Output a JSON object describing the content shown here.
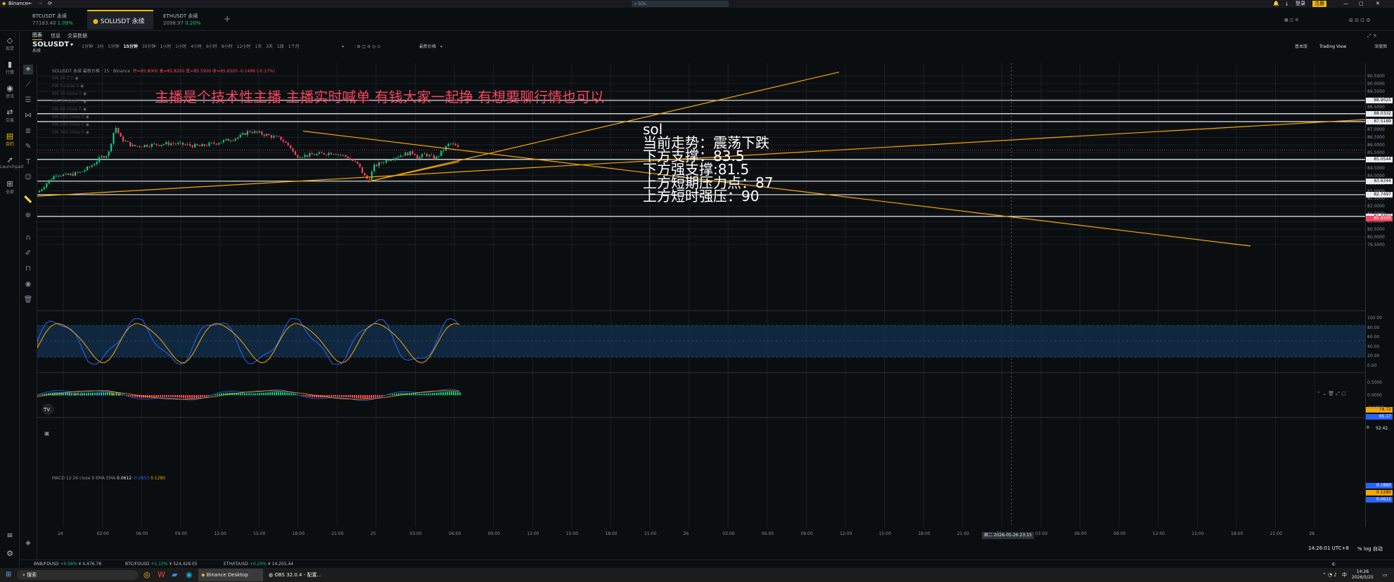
{
  "window": {
    "title": "Binance"
  },
  "tabs": [
    {
      "name": "BTCUSDT 永续",
      "price": "77183.40",
      "change": "1.09%"
    },
    {
      "name": "SOLUSDT 永续"
    },
    {
      "name": "ETHUSDT 永续",
      "price": "2098.97",
      "change": "0.20%"
    }
  ],
  "search": {
    "placeholder": "SOL"
  },
  "top_right": {
    "login": "登录",
    "register": "注册"
  },
  "left_nav": [
    {
      "label": "现货",
      "icon": "diamond-icon"
    },
    {
      "label": "行情",
      "icon": "bar-chart-icon"
    },
    {
      "label": "资讯",
      "icon": "news-icon"
    },
    {
      "label": "交易",
      "icon": "exchange-icon"
    },
    {
      "label": "合约",
      "icon": "contract-icon"
    },
    {
      "label": "Launchpad",
      "icon": "rocket-icon"
    },
    {
      "label": "全部",
      "icon": "grid-icon"
    }
  ],
  "subtabs": [
    "图表",
    "信息",
    "交易数据"
  ],
  "symbol": {
    "name": "SOLUSDT",
    "sub": "永续"
  },
  "intervals": [
    "1分钟",
    "3分",
    "5分钟",
    "15分钟",
    "30分钟",
    "1小时",
    "2小时",
    "4小时",
    "6小时",
    "8小时",
    "12小时",
    "1天",
    "3天",
    "1周",
    "1个月"
  ],
  "active_interval": "15分钟",
  "price_type": "最新价格",
  "views": [
    "基本版",
    "Trading View",
    "深度图"
  ],
  "legend": {
    "title": "SOLUSDT 永续 最新价格 · 15 · Binance",
    "ohlc": "开=85.8000 高=85.8200 低=85.5900 收=85.6500 -0.1499 (-0.17%)",
    "mas": [
      "MA 20 2 0",
      "MA 5 close 0",
      "MA 10 close 0",
      "MA 30 close 0",
      "MA 60 close 0",
      "MA 120 close 0",
      "MA 240 close 0",
      "MA 360 close 0"
    ]
  },
  "stream_banner": "主播是个技术性主播 主播实时喊单 有钱大家一起挣 有想要聊行情也可以",
  "analysis": {
    "symbol": "sol",
    "lines": [
      "当前走势：震荡下跌",
      "下方支撑：83.5",
      "下方强支撑:81.5",
      "上方短期压力点：87",
      "上方短时强压：90"
    ]
  },
  "price_axis": {
    "ticks": [
      "90.5000",
      "90.0000",
      "89.5000",
      "89.0000",
      "88.5000",
      "88.0000",
      "87.5000",
      "87.0000",
      "86.5000",
      "86.0000",
      "85.5000",
      "85.0000",
      "84.5000",
      "84.0000",
      "83.5000",
      "83.0000",
      "82.5000",
      "82.0000",
      "81.5000",
      "81.0000",
      "80.5000",
      "80.0000",
      "79.5000"
    ],
    "levels": [
      "88.9025",
      "88.0332",
      "87.5189",
      "85.0544",
      "83.6344",
      "82.7497",
      "81.3307"
    ],
    "current": "85.6500"
  },
  "stoch": {
    "legend": "Stoch RSI 14 14 3 3",
    "k": "65.17",
    "d": "79.72",
    "ticks": [
      "100.00",
      "80.00",
      "60.00",
      "40.00",
      "20.00",
      "0.00"
    ],
    "mid": "52.42",
    "k_label": "65.17",
    "d_label": "79.72"
  },
  "macd": {
    "legend": "MACD 12 26 close 9 EMA EMA",
    "v1": "0.0612",
    "v2": "-0.0853",
    "v3": "0.1280",
    "labels": [
      "0.1893",
      "0.1280",
      "0.0612"
    ],
    "ticks": [
      "0.5000",
      "0.0000",
      "-0.5000"
    ]
  },
  "time_axis": [
    "24",
    "03:00",
    "06:00",
    "09:00",
    "12:00",
    "15:00",
    "18:00",
    "21:00",
    "25",
    "03:00",
    "06:00",
    "09:00",
    "12:00",
    "15:00",
    "18:00",
    "21:00",
    "26",
    "03:00",
    "06:00",
    "09:00",
    "12:00",
    "15:00",
    "18:00",
    "21:00",
    "27",
    "03:00",
    "06:00",
    "09:00",
    "12:00",
    "15:00",
    "18:00",
    "21:00",
    "28"
  ],
  "crosshair_time": "周二 2026-05-26  23:15",
  "clock": "14:26:01 UTC+8",
  "scale_btns": [
    "%",
    "log",
    "自动"
  ],
  "tickers": [
    {
      "pair": "BNB/FDUSD",
      "chg": "+0.56%",
      "price": "¥ 4,476.78"
    },
    {
      "pair": "BTC/FDUSD",
      "chg": "+1.13%",
      "price": "¥ 524,428.05"
    },
    {
      "pair": "ETH/FDUSD",
      "chg": "+0.20%",
      "price": "¥ 14,255.44"
    }
  ],
  "taskbar": {
    "search": "搜索",
    "apps": [
      "Binance Desktop",
      "OBS 32.0.4 - 配置..."
    ],
    "time": "14:26",
    "date": "2026/5/25",
    "ime": "中"
  },
  "colors": {
    "up": "#0ecb81",
    "down": "#f6465d",
    "accent": "#f0b90b",
    "trendline": "#f7a600",
    "banner": "#f6465d"
  }
}
